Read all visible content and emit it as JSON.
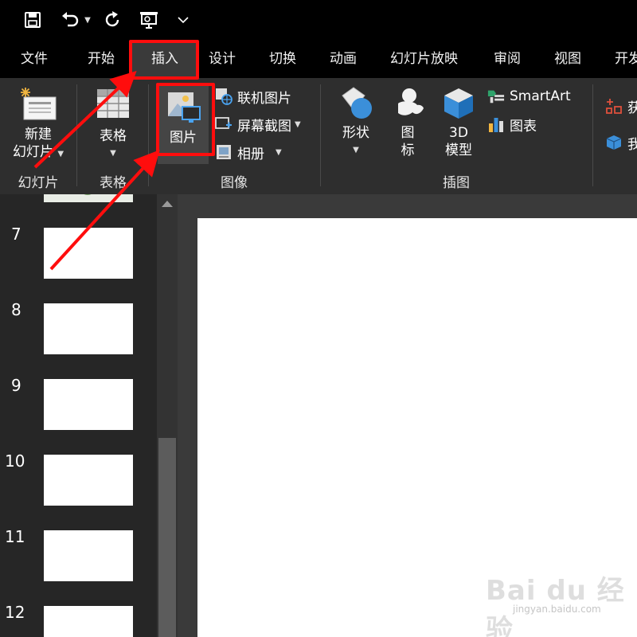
{
  "tabs": [
    "文件",
    "开始",
    "插入",
    "设计",
    "切换",
    "动画",
    "幻灯片放映",
    "审阅",
    "视图",
    "开发"
  ],
  "active_tab": "插入",
  "ribbon": {
    "new_slide": {
      "line1": "新建",
      "line2": "幻灯片"
    },
    "slides_group": "幻灯片",
    "table": {
      "label": "表格",
      "group": "表格"
    },
    "picture": {
      "label": "图片"
    },
    "online_pictures": "联机图片",
    "screenshot": "屏幕截图",
    "photo_album": "相册",
    "images_group": "图像",
    "shapes": "形状",
    "icons": {
      "line1": "图",
      "line2": "标"
    },
    "models": {
      "line1": "3D",
      "line2": "模型"
    },
    "smartart": "SmartArt",
    "chart": "图表",
    "illustrations_group": "插图",
    "cut_1": "获",
    "cut_2": "我"
  },
  "slide_numbers": [
    "7",
    "8",
    "9",
    "10",
    "11",
    "12"
  ],
  "watermark": {
    "main": "Bai du 经验",
    "sub": "jingyan.baidu.com"
  },
  "colors": {
    "accent": "#ff0d0d",
    "ribbon": "#2e2e2e",
    "titlebar": "#000000"
  }
}
